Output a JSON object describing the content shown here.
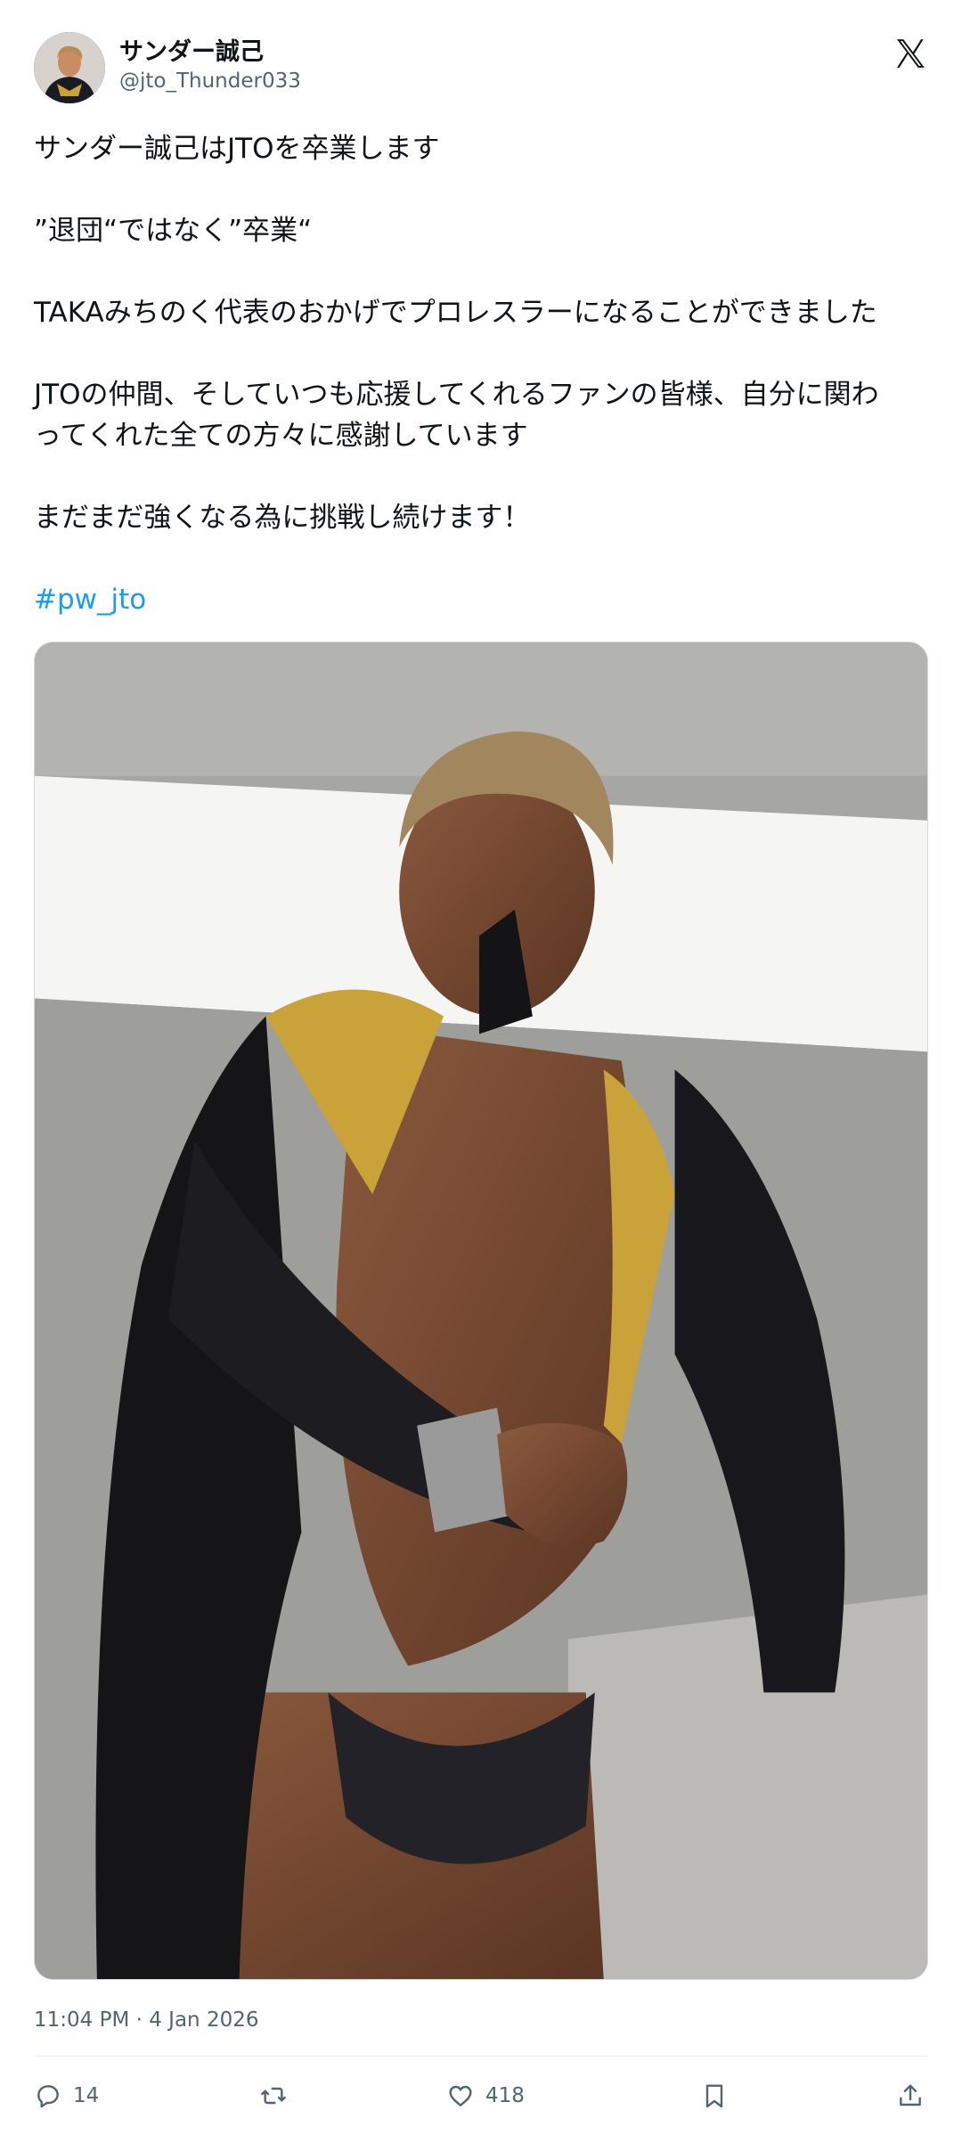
{
  "author": {
    "display_name": "サンダー誠己",
    "handle": "@jto_Thunder033"
  },
  "post": {
    "paragraphs": [
      "サンダー誠己はJTOを卒業します",
      "”退団“ではなく”卒業“",
      "TAKAみちのく代表のおかげでプロレスラーになることができました",
      "JTOの仲間、そしていつも応援してくれるファンの皆様、自分に関わ\nってくれた全ての方々に感謝しています",
      "まだまだ強くなる為に挑戦し続けます！"
    ],
    "hashtag": "#pw_jto",
    "timestamp": "11:04 PM · 4 Jan 2026"
  },
  "actions": {
    "replies": "14",
    "likes": "418"
  },
  "icons": {
    "logo": "x-logo-icon",
    "reply": "reply-icon",
    "repost": "repost-icon",
    "like": "heart-icon",
    "bookmark": "bookmark-icon",
    "share": "share-icon"
  },
  "colors": {
    "link": "#1d9bf0",
    "secondary_text": "#536471",
    "primary_text": "#0f1419"
  }
}
